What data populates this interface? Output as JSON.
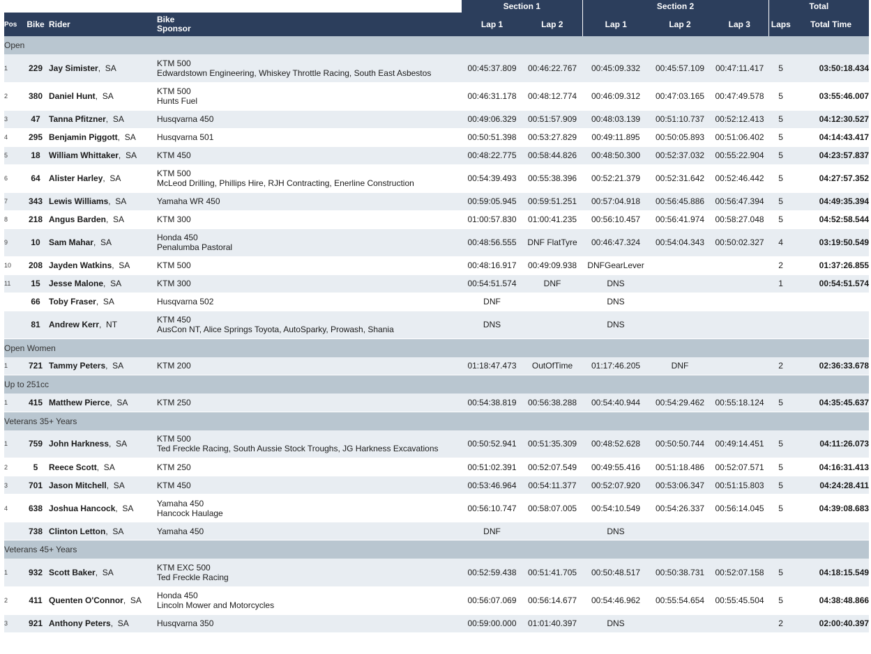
{
  "header": {
    "section1": "Section 1",
    "section2": "Section 2",
    "total": "Total",
    "pos": "Pos",
    "bike": "Bike",
    "rider": "Rider",
    "bike_sponsor_line1": "Bike",
    "bike_sponsor_line2": "Sponsor",
    "lap1": "Lap 1",
    "lap2": "Lap 2",
    "s2_lap1": "Lap 1",
    "s2_lap2": "Lap 2",
    "s2_lap3": "Lap 3",
    "laps": "Laps",
    "total_time": "Total Time"
  },
  "categories": [
    {
      "name": "Open",
      "rows": [
        {
          "pos": "1",
          "bike": "229",
          "rider": "Jay Simister",
          "state": "SA",
          "bike_model": "KTM 500",
          "sponsor": "Edwardstown Engineering, Whiskey Throttle Racing, South East Asbestos",
          "s1l1": "00:45:37.809",
          "s1l2": "00:46:22.767",
          "s2l1": "00:45:09.332",
          "s2l2": "00:45:57.109",
          "s2l3": "00:47:11.417",
          "laps": "5",
          "total": "03:50:18.434"
        },
        {
          "pos": "2",
          "bike": "380",
          "rider": "Daniel Hunt",
          "state": "SA",
          "bike_model": "KTM 500",
          "sponsor": "Hunts Fuel",
          "s1l1": "00:46:31.178",
          "s1l2": "00:48:12.774",
          "s2l1": "00:46:09.312",
          "s2l2": "00:47:03.165",
          "s2l3": "00:47:49.578",
          "laps": "5",
          "total": "03:55:46.007"
        },
        {
          "pos": "3",
          "bike": "47",
          "rider": "Tanna Pfitzner",
          "state": "SA",
          "bike_model": "Husqvarna 450",
          "sponsor": "",
          "s1l1": "00:49:06.329",
          "s1l2": "00:51:57.909",
          "s2l1": "00:48:03.139",
          "s2l2": "00:51:10.737",
          "s2l3": "00:52:12.413",
          "laps": "5",
          "total": "04:12:30.527"
        },
        {
          "pos": "4",
          "bike": "295",
          "rider": "Benjamin Piggott",
          "state": "SA",
          "bike_model": "Husqvarna 501",
          "sponsor": "",
          "s1l1": "00:50:51.398",
          "s1l2": "00:53:27.829",
          "s2l1": "00:49:11.895",
          "s2l2": "00:50:05.893",
          "s2l3": "00:51:06.402",
          "laps": "5",
          "total": "04:14:43.417"
        },
        {
          "pos": "5",
          "bike": "18",
          "rider": "William Whittaker",
          "state": "SA",
          "bike_model": "KTM 450",
          "sponsor": "",
          "s1l1": "00:48:22.775",
          "s1l2": "00:58:44.826",
          "s2l1": "00:48:50.300",
          "s2l2": "00:52:37.032",
          "s2l3": "00:55:22.904",
          "laps": "5",
          "total": "04:23:57.837"
        },
        {
          "pos": "6",
          "bike": "64",
          "rider": "Alister Harley",
          "state": "SA",
          "bike_model": "KTM 500",
          "sponsor": "McLeod Drilling, Phillips Hire, RJH Contracting, Enerline Construction",
          "s1l1": "00:54:39.493",
          "s1l2": "00:55:38.396",
          "s2l1": "00:52:21.379",
          "s2l2": "00:52:31.642",
          "s2l3": "00:52:46.442",
          "laps": "5",
          "total": "04:27:57.352"
        },
        {
          "pos": "7",
          "bike": "343",
          "rider": "Lewis Williams",
          "state": "SA",
          "bike_model": "Yamaha WR 450",
          "sponsor": "",
          "s1l1": "00:59:05.945",
          "s1l2": "00:59:51.251",
          "s2l1": "00:57:04.918",
          "s2l2": "00:56:45.886",
          "s2l3": "00:56:47.394",
          "laps": "5",
          "total": "04:49:35.394"
        },
        {
          "pos": "8",
          "bike": "218",
          "rider": "Angus Barden",
          "state": "SA",
          "bike_model": "KTM 300",
          "sponsor": "",
          "s1l1": "01:00:57.830",
          "s1l2": "01:00:41.235",
          "s2l1": "00:56:10.457",
          "s2l2": "00:56:41.974",
          "s2l3": "00:58:27.048",
          "laps": "5",
          "total": "04:52:58.544"
        },
        {
          "pos": "9",
          "bike": "10",
          "rider": "Sam Mahar",
          "state": "SA",
          "bike_model": "Honda 450",
          "sponsor": "Penalumba Pastoral",
          "s1l1": "00:48:56.555",
          "s1l2": "DNF FlatTyre",
          "s2l1": "00:46:47.324",
          "s2l2": "00:54:04.343",
          "s2l3": "00:50:02.327",
          "laps": "4",
          "total": "03:19:50.549"
        },
        {
          "pos": "10",
          "bike": "208",
          "rider": "Jayden Watkins",
          "state": "SA",
          "bike_model": "KTM 500",
          "sponsor": "",
          "s1l1": "00:48:16.917",
          "s1l2": "00:49:09.938",
          "s2l1": "DNFGearLever",
          "s2l2": "",
          "s2l3": "",
          "laps": "2",
          "total": "01:37:26.855"
        },
        {
          "pos": "11",
          "bike": "15",
          "rider": "Jesse Malone",
          "state": "SA",
          "bike_model": "KTM 300",
          "sponsor": "",
          "s1l1": "00:54:51.574",
          "s1l2": "DNF",
          "s2l1": "DNS",
          "s2l2": "",
          "s2l3": "",
          "laps": "1",
          "total": "00:54:51.574"
        },
        {
          "pos": "",
          "bike": "66",
          "rider": "Toby Fraser",
          "state": "SA",
          "bike_model": "Husqvarna 502",
          "sponsor": "",
          "s1l1": "DNF",
          "s1l2": "",
          "s2l1": "DNS",
          "s2l2": "",
          "s2l3": "",
          "laps": "",
          "total": ""
        },
        {
          "pos": "",
          "bike": "81",
          "rider": "Andrew Kerr",
          "state": "NT",
          "bike_model": "KTM 450",
          "sponsor": "AusCon NT, Alice Springs Toyota, AutoSparky, Prowash, Shania",
          "s1l1": "DNS",
          "s1l2": "",
          "s2l1": "DNS",
          "s2l2": "",
          "s2l3": "",
          "laps": "",
          "total": ""
        }
      ]
    },
    {
      "name": "Open Women",
      "rows": [
        {
          "pos": "1",
          "bike": "721",
          "rider": "Tammy Peters",
          "state": "SA",
          "bike_model": "KTM 200",
          "sponsor": "",
          "s1l1": "01:18:47.473",
          "s1l2": "OutOfTime",
          "s2l1": "01:17:46.205",
          "s2l2": "DNF",
          "s2l3": "",
          "laps": "2",
          "total": "02:36:33.678"
        }
      ]
    },
    {
      "name": "Up to 251cc",
      "rows": [
        {
          "pos": "1",
          "bike": "415",
          "rider": "Matthew Pierce",
          "state": "SA",
          "bike_model": "KTM 250",
          "sponsor": "",
          "s1l1": "00:54:38.819",
          "s1l2": "00:56:38.288",
          "s2l1": "00:54:40.944",
          "s2l2": "00:54:29.462",
          "s2l3": "00:55:18.124",
          "laps": "5",
          "total": "04:35:45.637"
        }
      ]
    },
    {
      "name": "Veterans 35+ Years",
      "rows": [
        {
          "pos": "1",
          "bike": "759",
          "rider": "John Harkness",
          "state": "SA",
          "bike_model": "KTM 500",
          "sponsor": "Ted Freckle Racing, South Aussie Stock Troughs, JG Harkness Excavations",
          "s1l1": "00:50:52.941",
          "s1l2": "00:51:35.309",
          "s2l1": "00:48:52.628",
          "s2l2": "00:50:50.744",
          "s2l3": "00:49:14.451",
          "laps": "5",
          "total": "04:11:26.073"
        },
        {
          "pos": "2",
          "bike": "5",
          "rider": "Reece Scott",
          "state": "SA",
          "bike_model": "KTM 250",
          "sponsor": "",
          "s1l1": "00:51:02.391",
          "s1l2": "00:52:07.549",
          "s2l1": "00:49:55.416",
          "s2l2": "00:51:18.486",
          "s2l3": "00:52:07.571",
          "laps": "5",
          "total": "04:16:31.413"
        },
        {
          "pos": "3",
          "bike": "701",
          "rider": "Jason Mitchell",
          "state": "SA",
          "bike_model": "KTM 450",
          "sponsor": "",
          "s1l1": "00:53:46.964",
          "s1l2": "00:54:11.377",
          "s2l1": "00:52:07.920",
          "s2l2": "00:53:06.347",
          "s2l3": "00:51:15.803",
          "laps": "5",
          "total": "04:24:28.411"
        },
        {
          "pos": "4",
          "bike": "638",
          "rider": "Joshua Hancock",
          "state": "SA",
          "bike_model": "Yamaha 450",
          "sponsor": "Hancock Haulage",
          "s1l1": "00:56:10.747",
          "s1l2": "00:58:07.005",
          "s2l1": "00:54:10.549",
          "s2l2": "00:54:26.337",
          "s2l3": "00:56:14.045",
          "laps": "5",
          "total": "04:39:08.683"
        },
        {
          "pos": "",
          "bike": "738",
          "rider": "Clinton Letton",
          "state": "SA",
          "bike_model": "Yamaha 450",
          "sponsor": "",
          "s1l1": "DNF",
          "s1l2": "",
          "s2l1": "DNS",
          "s2l2": "",
          "s2l3": "",
          "laps": "",
          "total": ""
        }
      ]
    },
    {
      "name": "Veterans 45+ Years",
      "rows": [
        {
          "pos": "1",
          "bike": "932",
          "rider": "Scott Baker",
          "state": "SA",
          "bike_model": "KTM EXC 500",
          "sponsor": "Ted Freckle Racing",
          "s1l1": "00:52:59.438",
          "s1l2": "00:51:41.705",
          "s2l1": "00:50:48.517",
          "s2l2": "00:50:38.731",
          "s2l3": "00:52:07.158",
          "laps": "5",
          "total": "04:18:15.549"
        },
        {
          "pos": "2",
          "bike": "411",
          "rider": "Quenten O'Connor",
          "state": "SA",
          "bike_model": "Honda 450",
          "sponsor": "Lincoln Mower and Motorcycles",
          "s1l1": "00:56:07.069",
          "s1l2": "00:56:14.677",
          "s2l1": "00:54:46.962",
          "s2l2": "00:55:54.654",
          "s2l3": "00:55:45.504",
          "laps": "5",
          "total": "04:38:48.866"
        },
        {
          "pos": "3",
          "bike": "921",
          "rider": "Anthony Peters",
          "state": "SA",
          "bike_model": "Husqvarna 350",
          "sponsor": "",
          "s1l1": "00:59:00.000",
          "s1l2": "01:01:40.397",
          "s2l1": "DNS",
          "s2l2": "",
          "s2l3": "",
          "laps": "2",
          "total": "02:00:40.397"
        }
      ]
    }
  ]
}
